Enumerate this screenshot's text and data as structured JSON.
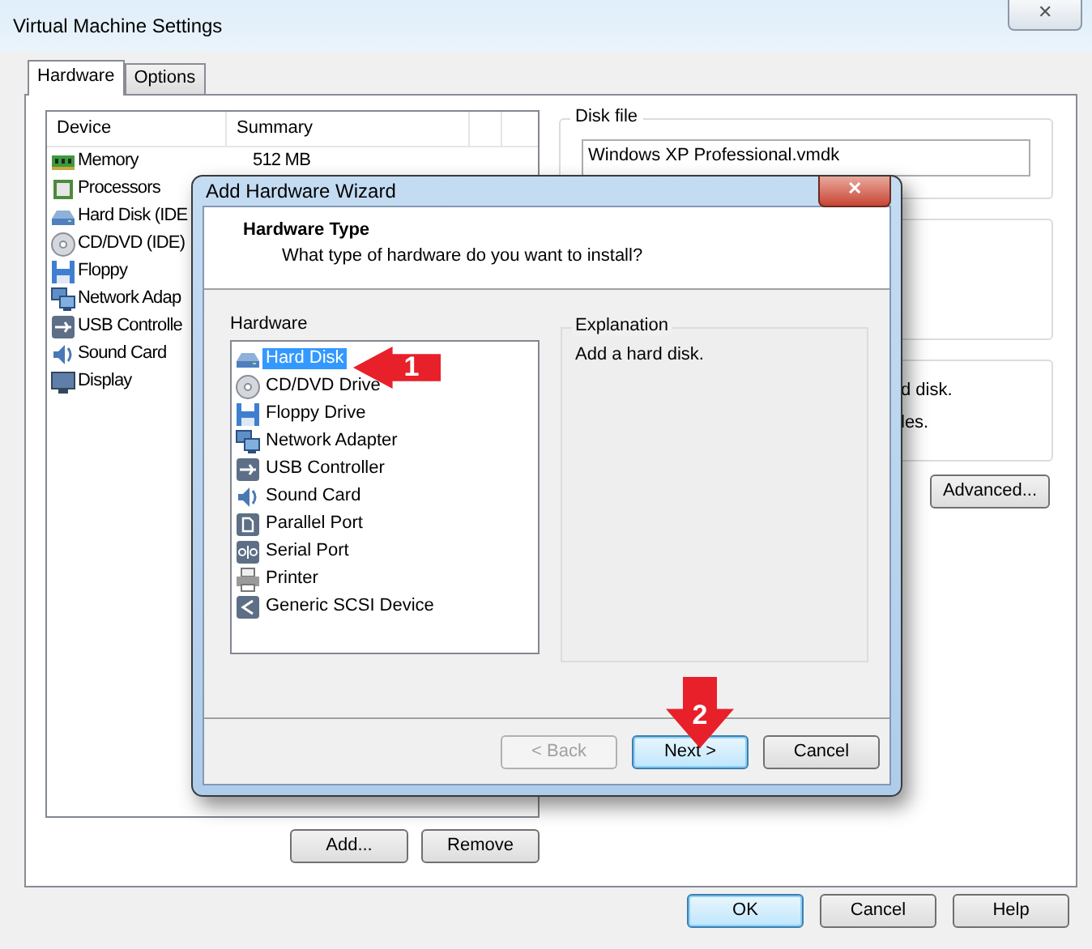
{
  "window": {
    "title": "Virtual Machine Settings",
    "close": "✕"
  },
  "tabs": [
    {
      "label": "Hardware",
      "selected": true
    },
    {
      "label": "Options",
      "selected": false
    }
  ],
  "device_table": {
    "columns": [
      "Device",
      "Summary"
    ],
    "rows": [
      {
        "kind": "memory",
        "device": "Memory",
        "summary": "512 MB",
        "selected": false
      },
      {
        "kind": "processor",
        "device": "Processors",
        "selected": false
      },
      {
        "kind": "disk",
        "device": "Hard Disk (IDE",
        "selected": false
      },
      {
        "kind": "cd",
        "device": "CD/DVD (IDE)",
        "selected": false
      },
      {
        "kind": "floppy",
        "device": "Floppy",
        "selected": false
      },
      {
        "kind": "network",
        "device": "Network Adap",
        "selected": false
      },
      {
        "kind": "usb",
        "device": "USB Controlle",
        "selected": false
      },
      {
        "kind": "sound",
        "device": "Sound Card",
        "selected": false
      },
      {
        "kind": "display",
        "device": "Display",
        "selected": false
      }
    ]
  },
  "list_buttons": [
    "Add...",
    "Remove"
  ],
  "disk_file": {
    "label": "Disk file",
    "value": "Windows XP Professional.vmdk"
  },
  "partial_texts": [
    "d disk.",
    "les."
  ],
  "advanced_button": "Advanced...",
  "dialog_buttons": [
    {
      "label": "OK",
      "default": true
    },
    {
      "label": "Cancel",
      "default": false
    },
    {
      "label": "Help",
      "default": false
    }
  ],
  "wizard": {
    "title": "Add Hardware Wizard",
    "close": "✕",
    "heading": "Hardware Type",
    "subheading": "What type of hardware do you want to install?",
    "list_label": "Hardware",
    "items": [
      {
        "kind": "disk",
        "label": "Hard Disk",
        "selected": true
      },
      {
        "kind": "cd",
        "label": "CD/DVD Drive",
        "selected": false
      },
      {
        "kind": "floppy",
        "label": "Floppy Drive",
        "selected": false
      },
      {
        "kind": "network",
        "label": "Network Adapter",
        "selected": false
      },
      {
        "kind": "usb",
        "label": "USB Controller",
        "selected": false
      },
      {
        "kind": "sound",
        "label": "Sound Card",
        "selected": false
      },
      {
        "kind": "parallel",
        "label": "Parallel Port",
        "selected": false
      },
      {
        "kind": "serial",
        "label": "Serial Port",
        "selected": false
      },
      {
        "kind": "printer",
        "label": "Printer",
        "selected": false
      },
      {
        "kind": "scsi",
        "label": "Generic SCSI Device",
        "selected": false
      }
    ],
    "explanation_label": "Explanation",
    "explanation": "Add a hard disk.",
    "buttons": [
      {
        "label": "< Back",
        "disabled": true,
        "default": false
      },
      {
        "label": "Next >",
        "disabled": false,
        "default": true
      },
      {
        "label": "Cancel",
        "disabled": false,
        "default": false
      }
    ]
  },
  "annotations": [
    {
      "label": "1",
      "kind": "left"
    },
    {
      "label": "2",
      "kind": "down"
    }
  ]
}
